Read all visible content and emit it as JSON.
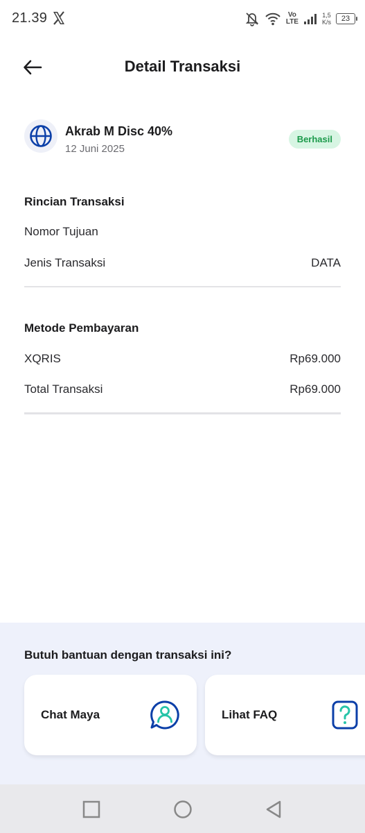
{
  "status_bar": {
    "time": "21.39",
    "network_top": "Vo",
    "network_bottom": "LTE",
    "speed_top": "1,5",
    "speed_bottom": "K/s",
    "battery": "23"
  },
  "header": {
    "title": "Detail Transaksi",
    "back_icon": "arrow-left-icon"
  },
  "product": {
    "icon": "globe-icon",
    "name": "Akrab M Disc 40%",
    "date": "12 Juni 2025",
    "status": "Berhasil"
  },
  "rincian": {
    "title": "Rincian Transaksi",
    "rows": [
      {
        "label": "Nomor Tujuan",
        "value": ""
      },
      {
        "label": "Jenis Transaksi",
        "value": "DATA"
      }
    ]
  },
  "pembayaran": {
    "title": "Metode Pembayaran",
    "rows": [
      {
        "label": "XQRIS",
        "value": "Rp69.000"
      },
      {
        "label": "Total Transaksi",
        "value": "Rp69.000"
      }
    ]
  },
  "help": {
    "title": "Butuh bantuan dengan transaksi ini?",
    "cards": [
      {
        "label": "Chat Maya",
        "icon": "chat-person-icon"
      },
      {
        "label": "Lihat FAQ",
        "icon": "question-icon"
      }
    ]
  },
  "colors": {
    "accent": "#0b3fa8",
    "success_bg": "#d7f5e3",
    "success_text": "#1c9a4b",
    "help_bg": "#eef1fb",
    "teal": "#27c4a8"
  }
}
